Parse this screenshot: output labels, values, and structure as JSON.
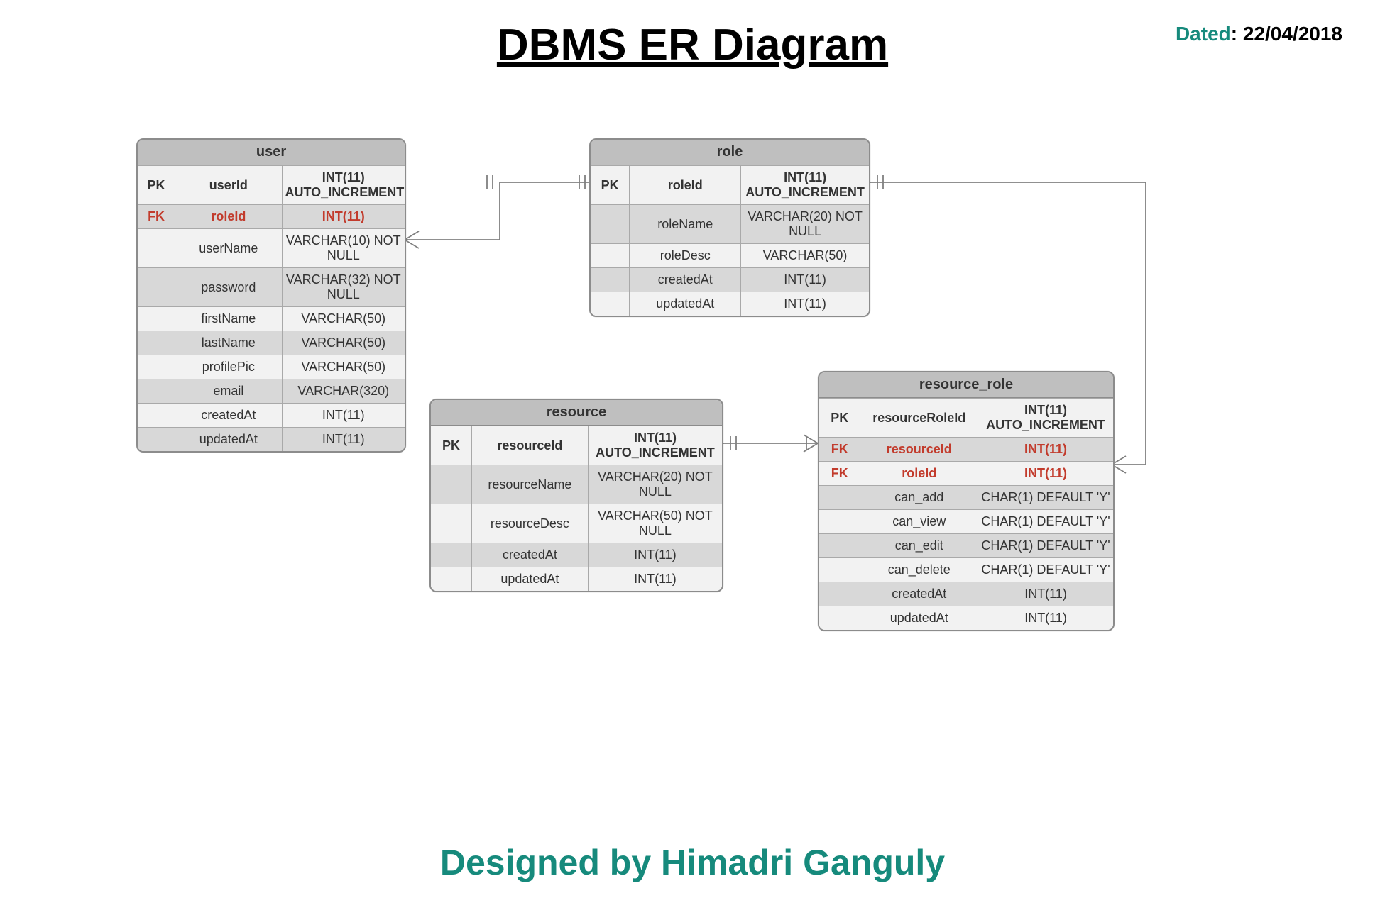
{
  "title": "DBMS ER Diagram",
  "dated_label": "Dated",
  "dated_value": ": 22/04/2018",
  "footer": "Designed by Himadri Ganguly",
  "entities": {
    "user": {
      "name": "user",
      "rows": [
        {
          "key": "PK",
          "col": "userId",
          "type": "INT(11) AUTO_INCREMENT",
          "pk": true
        },
        {
          "key": "FK",
          "col": "roleId",
          "type": "INT(11)",
          "fk": true
        },
        {
          "key": "",
          "col": "userName",
          "type": "VARCHAR(10) NOT NULL"
        },
        {
          "key": "",
          "col": "password",
          "type": "VARCHAR(32) NOT NULL"
        },
        {
          "key": "",
          "col": "firstName",
          "type": "VARCHAR(50)"
        },
        {
          "key": "",
          "col": "lastName",
          "type": "VARCHAR(50)"
        },
        {
          "key": "",
          "col": "profilePic",
          "type": "VARCHAR(50)"
        },
        {
          "key": "",
          "col": "email",
          "type": "VARCHAR(320)"
        },
        {
          "key": "",
          "col": "createdAt",
          "type": "INT(11)"
        },
        {
          "key": "",
          "col": "updatedAt",
          "type": "INT(11)"
        }
      ]
    },
    "role": {
      "name": "role",
      "rows": [
        {
          "key": "PK",
          "col": "roleId",
          "type": "INT(11) AUTO_INCREMENT",
          "pk": true
        },
        {
          "key": "",
          "col": "roleName",
          "type": "VARCHAR(20) NOT NULL"
        },
        {
          "key": "",
          "col": "roleDesc",
          "type": "VARCHAR(50)"
        },
        {
          "key": "",
          "col": "createdAt",
          "type": "INT(11)"
        },
        {
          "key": "",
          "col": "updatedAt",
          "type": "INT(11)"
        }
      ]
    },
    "resource": {
      "name": "resource",
      "rows": [
        {
          "key": "PK",
          "col": "resourceId",
          "type": "INT(11) AUTO_INCREMENT",
          "pk": true
        },
        {
          "key": "",
          "col": "resourceName",
          "type": "VARCHAR(20) NOT NULL"
        },
        {
          "key": "",
          "col": "resourceDesc",
          "type": "VARCHAR(50) NOT NULL"
        },
        {
          "key": "",
          "col": "createdAt",
          "type": "INT(11)"
        },
        {
          "key": "",
          "col": "updatedAt",
          "type": "INT(11)"
        }
      ]
    },
    "resource_role": {
      "name": "resource_role",
      "rows": [
        {
          "key": "PK",
          "col": "resourceRoleId",
          "type": "INT(11) AUTO_INCREMENT",
          "pk": true
        },
        {
          "key": "FK",
          "col": "resourceId",
          "type": "INT(11)",
          "fk": true
        },
        {
          "key": "FK",
          "col": "roleId",
          "type": "INT(11)",
          "fk": true
        },
        {
          "key": "",
          "col": "can_add",
          "type": "CHAR(1) DEFAULT 'Y'"
        },
        {
          "key": "",
          "col": "can_view",
          "type": "CHAR(1) DEFAULT 'Y'"
        },
        {
          "key": "",
          "col": "can_edit",
          "type": "CHAR(1) DEFAULT 'Y'"
        },
        {
          "key": "",
          "col": "can_delete",
          "type": "CHAR(1) DEFAULT 'Y'"
        },
        {
          "key": "",
          "col": "createdAt",
          "type": "INT(11)"
        },
        {
          "key": "",
          "col": "updatedAt",
          "type": "INT(11)"
        }
      ]
    }
  },
  "relationships": [
    {
      "from": "user.roleId",
      "to": "role.roleId",
      "type": "many-to-one"
    },
    {
      "from": "resource_role.roleId",
      "to": "role.roleId",
      "type": "many-to-one"
    },
    {
      "from": "resource_role.resourceId",
      "to": "resource.resourceId",
      "type": "many-to-one"
    }
  ]
}
